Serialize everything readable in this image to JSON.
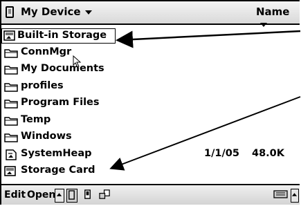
{
  "header": {
    "location": "My Device",
    "sort_by": "Name"
  },
  "files": [
    {
      "name": "Built-in Storage",
      "icon": "storage-card-icon",
      "date": "",
      "size": ""
    },
    {
      "name": "ConnMgr",
      "icon": "folder-icon",
      "date": "",
      "size": ""
    },
    {
      "name": "My Documents",
      "icon": "folder-icon",
      "date": "",
      "size": ""
    },
    {
      "name": "profiles",
      "icon": "folder-icon",
      "date": "",
      "size": ""
    },
    {
      "name": "Program Files",
      "icon": "folder-icon",
      "date": "",
      "size": ""
    },
    {
      "name": "Temp",
      "icon": "folder-icon",
      "date": "",
      "size": ""
    },
    {
      "name": "Windows",
      "icon": "folder-icon",
      "date": "",
      "size": ""
    },
    {
      "name": "SystemHeap",
      "icon": "file-icon",
      "date": "1/1/05",
      "size": "48.0K"
    },
    {
      "name": "Storage Card",
      "icon": "storage-card-icon",
      "date": "",
      "size": ""
    }
  ],
  "menu": {
    "edit": "Edit",
    "open": "Open"
  }
}
